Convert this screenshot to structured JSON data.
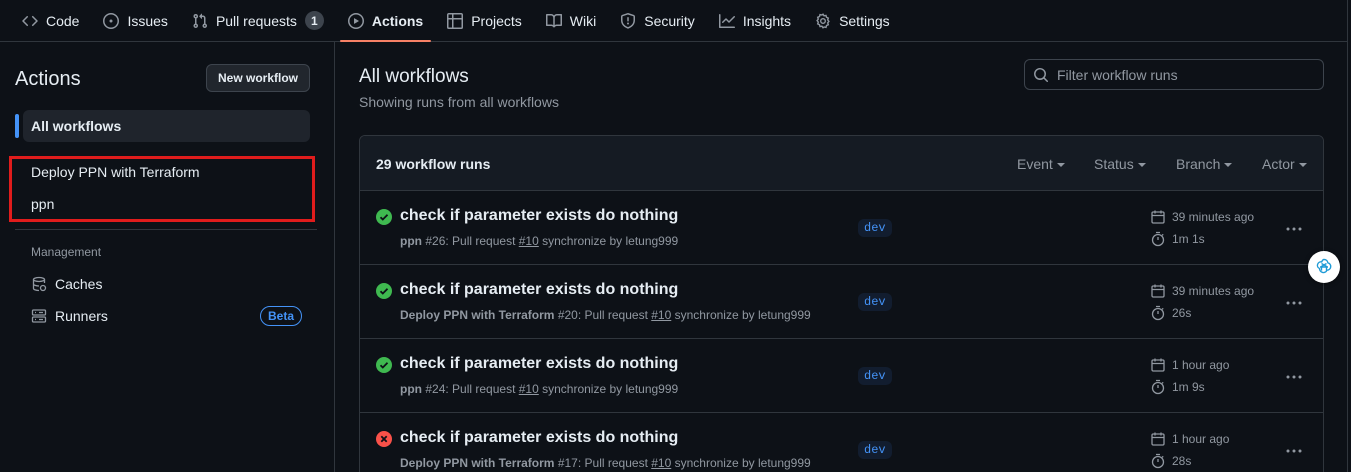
{
  "nav": {
    "tabs": [
      {
        "label": "Code",
        "icon": "code-icon"
      },
      {
        "label": "Issues",
        "icon": "issue-opened-icon"
      },
      {
        "label": "Pull requests",
        "icon": "git-pull-request-icon",
        "count": "1"
      },
      {
        "label": "Actions",
        "icon": "play-icon",
        "active": true
      },
      {
        "label": "Projects",
        "icon": "table-icon"
      },
      {
        "label": "Wiki",
        "icon": "book-icon"
      },
      {
        "label": "Security",
        "icon": "shield-icon"
      },
      {
        "label": "Insights",
        "icon": "graph-icon"
      },
      {
        "label": "Settings",
        "icon": "gear-icon"
      }
    ]
  },
  "sidebar": {
    "title": "Actions",
    "new_workflow": "New workflow",
    "all_workflows": "All workflows",
    "workflows": [
      "Deploy PPN with Terraform",
      "ppn"
    ],
    "management_heading": "Management",
    "caches": "Caches",
    "runners": "Runners",
    "beta": "Beta"
  },
  "main": {
    "title": "All workflows",
    "subtitle": "Showing runs from all workflows",
    "filter_placeholder": "Filter workflow runs",
    "runs_count": "29 workflow runs",
    "filters": [
      "Event",
      "Status",
      "Branch",
      "Actor"
    ]
  },
  "runs": [
    {
      "status": "success",
      "title": "check if parameter exists do nothing",
      "workflow": "ppn",
      "number": "#26",
      "event_text": ": Pull request ",
      "pr": "#10",
      "suffix": " synchronize by letung999",
      "branch": "dev",
      "when": "39 minutes ago",
      "duration": "1m 1s"
    },
    {
      "status": "success",
      "title": "check if parameter exists do nothing",
      "workflow": "Deploy PPN with Terraform",
      "number": "#20",
      "event_text": ": Pull request ",
      "pr": "#10",
      "suffix": " synchronize by letung999",
      "branch": "dev",
      "when": "39 minutes ago",
      "duration": "26s"
    },
    {
      "status": "success",
      "title": "check if parameter exists do nothing",
      "workflow": "ppn",
      "number": "#24",
      "event_text": ": Pull request ",
      "pr": "#10",
      "suffix": " synchronize by letung999",
      "branch": "dev",
      "when": "1 hour ago",
      "duration": "1m 9s"
    },
    {
      "status": "failure",
      "title": "check if parameter exists do nothing",
      "workflow": "Deploy PPN with Terraform",
      "number": "#17",
      "event_text": ": Pull request ",
      "pr": "#10",
      "suffix": " synchronize by letung999",
      "branch": "dev",
      "when": "1 hour ago",
      "duration": "28s"
    }
  ],
  "colors": {
    "success": "#3fb950",
    "failure": "#f85149",
    "accent": "#4493f8",
    "active_tab": "#f78166",
    "highlight": "#e01c1c"
  }
}
